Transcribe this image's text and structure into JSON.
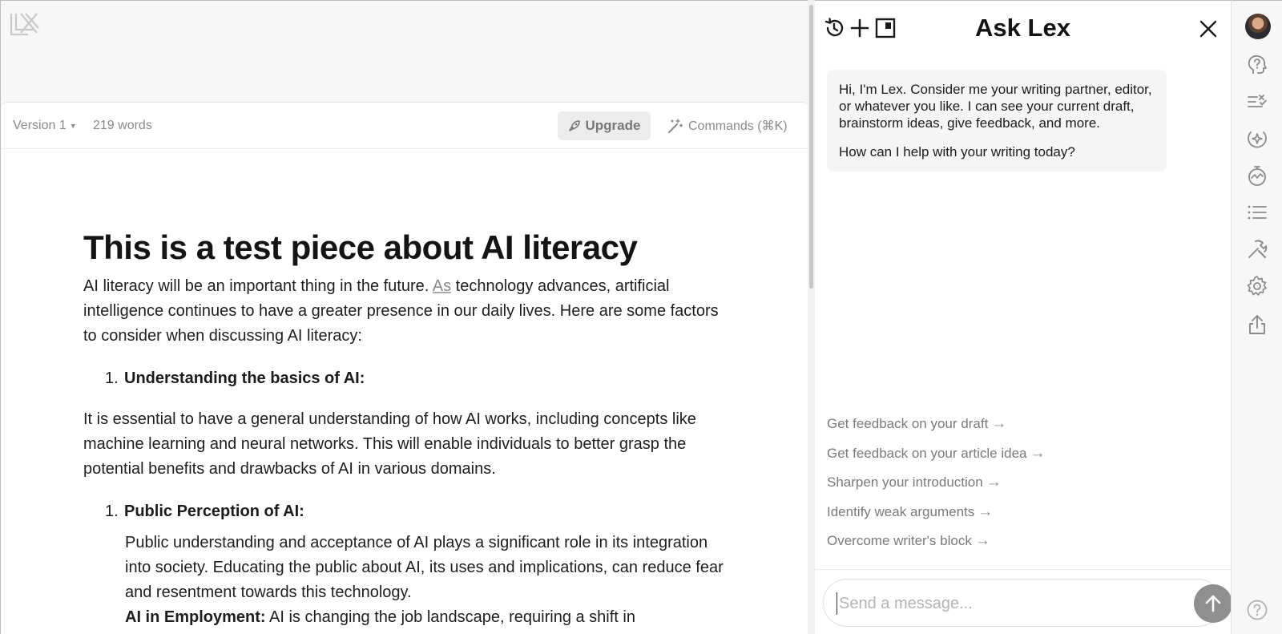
{
  "editor": {
    "version_label": "Version 1",
    "word_count": "219 words",
    "upgrade_label": "Upgrade",
    "commands_label": "Commands (⌘K)"
  },
  "document": {
    "title": "This is a test piece about AI literacy",
    "para1_a": "AI literacy will be an important thing in the future. ",
    "para1_link": "As",
    "para1_b": " technology advances, artificial intelligence continues to have a greater presence in our daily lives. Here are some factors to consider when discussing AI literacy:",
    "item1_num": "1.",
    "item1_heading": "Understanding the basics of AI:",
    "para2": " It is essential to have a general understanding of how AI works, including concepts like machine learning and neural networks. This will enable individuals to better grasp the potential benefits and drawbacks of AI in various domains.",
    "item2_num": "1.",
    "item2_heading": "Public Perception of AI:",
    "para3": " Public understanding and acceptance of AI plays a significant role in its integration into society. Educating the public about AI, its uses and implications, can reduce fear and resentment towards this technology.",
    "para4_heading": "AI in Employment:",
    "para4_text": " AI is changing the job landscape, requiring a shift in"
  },
  "lex": {
    "title": "Ask Lex",
    "greeting_1": "Hi, I'm Lex. Consider me your writing partner, editor, or whatever you like. I can see your current draft, brainstorm ideas, give feedback, and more.",
    "greeting_2": "How can I help with your writing today?",
    "suggestions": [
      "Get feedback on your draft",
      "Get feedback on your article idea",
      "Sharpen your introduction",
      "Identify weak arguments",
      "Overcome writer's block"
    ],
    "arrow": "→",
    "input_placeholder": "Send a message..."
  },
  "icons": {
    "header": [
      "history-icon",
      "plus-icon",
      "sidebar-toggle-icon",
      "close-icon"
    ],
    "rail": [
      "avatar",
      "ask-lex-icon",
      "checks-icon",
      "sparkle-target-icon",
      "readability-gauge-icon",
      "outline-list-icon",
      "tools-icon",
      "settings-gear-icon",
      "share-icon",
      "help-icon"
    ]
  },
  "colors": {
    "send_button": "#8f8f8f",
    "upgrade_bg": "#ececec"
  }
}
